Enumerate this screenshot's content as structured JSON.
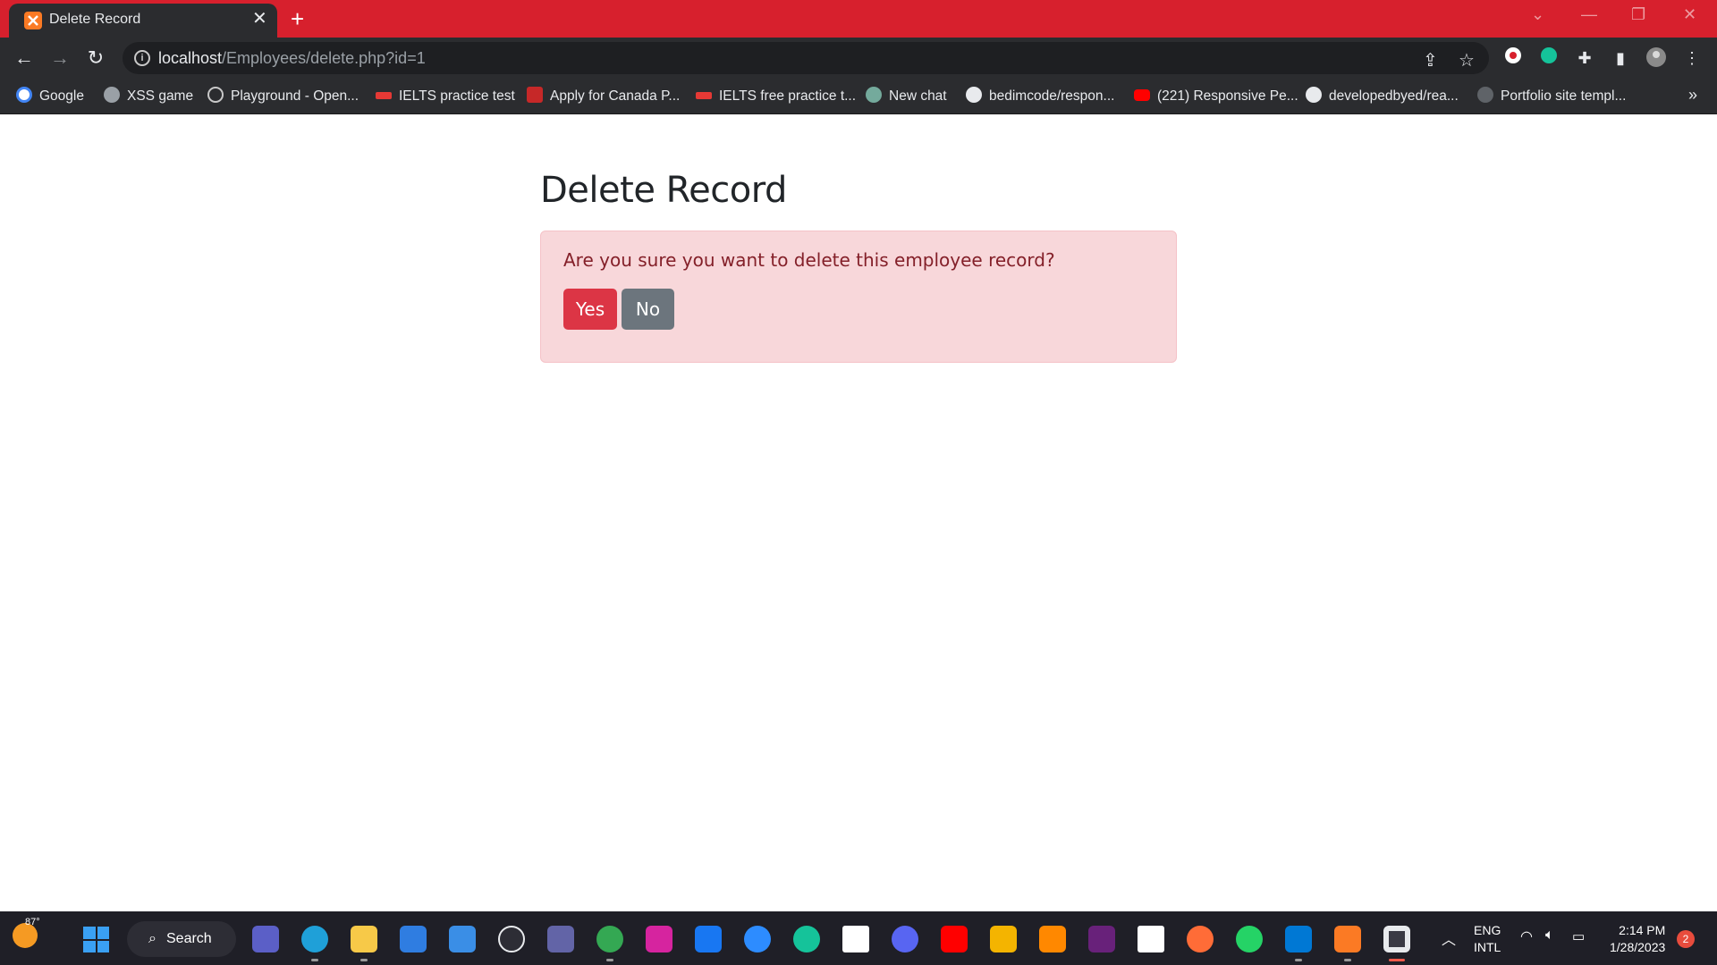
{
  "browser": {
    "tab_title": "Delete Record",
    "tab_close": "✕",
    "new_tab": "+",
    "url_host": "localhost",
    "url_path": "/Employees/delete.php?id=1",
    "bookmarks": [
      {
        "label": "Google",
        "icon": "google-icon",
        "color": "#4285f4"
      },
      {
        "label": "XSS game",
        "icon": "globe-icon",
        "color": "#9aa0a6"
      },
      {
        "label": "Playground - Open...",
        "icon": "openai-icon",
        "color": "#c8c8c8"
      },
      {
        "label": "IELTS practice test",
        "icon": "ielts-icon",
        "color": "#e53935"
      },
      {
        "label": "Apply for Canada P...",
        "icon": "shield-icon",
        "color": "#c62828"
      },
      {
        "label": "IELTS free practice t...",
        "icon": "ielts-icon",
        "color": "#e53935"
      },
      {
        "label": "New chat",
        "icon": "openai-icon",
        "color": "#74aa9c"
      },
      {
        "label": "bedimcode/respon...",
        "icon": "github-icon",
        "color": "#e8eaed"
      },
      {
        "label": "(221) Responsive Pe...",
        "icon": "youtube-icon",
        "color": "#ff0000"
      },
      {
        "label": "developedbyed/rea...",
        "icon": "github-icon",
        "color": "#e8eaed"
      },
      {
        "label": "Portfolio site templ...",
        "icon": "globe-icon",
        "color": "#5f6368"
      }
    ],
    "bookmarks_more": "»"
  },
  "page": {
    "heading": "Delete Record",
    "alert_text": "Are you sure you want to delete this employee record?",
    "yes_label": "Yes",
    "no_label": "No"
  },
  "taskbar": {
    "weather_temp": "87°",
    "search_label": "Search",
    "language_line1": "ENG",
    "language_line2": "INTL",
    "time": "2:14 PM",
    "date": "1/28/2023",
    "notification_count": "2",
    "apps": [
      {
        "name": "zoom-meet-icon",
        "color": "#5b5fc7"
      },
      {
        "name": "edge-icon",
        "color": "#1fa0d8"
      },
      {
        "name": "file-explorer-icon",
        "color": "#f7c948"
      },
      {
        "name": "store-icon",
        "color": "#2f7de1"
      },
      {
        "name": "mail-icon",
        "color": "#3a8ee6"
      },
      {
        "name": "dell-icon",
        "color": "#2d2d35"
      },
      {
        "name": "teams-icon",
        "color": "#6264a7"
      },
      {
        "name": "chrome-icon",
        "color": "#34a853"
      },
      {
        "name": "instagram-icon",
        "color": "#d6249f"
      },
      {
        "name": "facebook-icon",
        "color": "#1877f2"
      },
      {
        "name": "zoom-icon",
        "color": "#2d8cff"
      },
      {
        "name": "grammarly-icon",
        "color": "#15c39a"
      },
      {
        "name": "lt-icon",
        "color": "#ffffff"
      },
      {
        "name": "discord-icon",
        "color": "#5865f2"
      },
      {
        "name": "youtube-icon",
        "color": "#ff0000"
      },
      {
        "name": "vpn-icon",
        "color": "#f4b400"
      },
      {
        "name": "vlc-icon",
        "color": "#ff8800"
      },
      {
        "name": "visual-studio-icon",
        "color": "#68217a"
      },
      {
        "name": "wikipedia-icon",
        "color": "#ffffff"
      },
      {
        "name": "postman-icon",
        "color": "#ff6c37"
      },
      {
        "name": "whatsapp-icon",
        "color": "#25d366"
      },
      {
        "name": "vscode-icon",
        "color": "#0078d4"
      },
      {
        "name": "xampp-icon",
        "color": "#fb7a24"
      },
      {
        "name": "snipping-tool-icon",
        "color": "#e8eaed"
      }
    ]
  },
  "colors": {
    "titlebar": "#d7202d",
    "alert_bg": "#f8d7da",
    "alert_text": "#842029",
    "danger": "#dc3545",
    "secondary": "#6c757d"
  }
}
